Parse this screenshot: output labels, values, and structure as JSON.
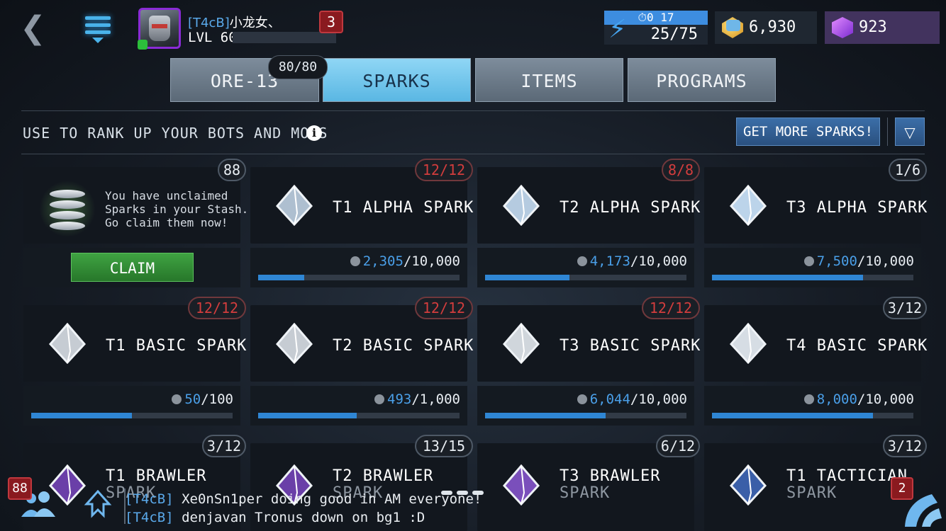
{
  "header": {
    "back_icon": "chevron-left-icon",
    "menu_icon": "menu-icon",
    "player": {
      "tag": "[T4cB]",
      "name": "小龙女、",
      "level": "LVL 60",
      "notifications": "3"
    },
    "energy": {
      "timer": "⏱0 17",
      "value": "25/75",
      "icon": "lightning-icon"
    },
    "gold": {
      "value": "6,930",
      "icon": "gold-icon"
    },
    "gems": {
      "value": "923",
      "icon": "gem-icon"
    }
  },
  "tabs": [
    {
      "label": "ORE-13",
      "active": false
    },
    {
      "label": "SPARKS",
      "active": true
    },
    {
      "label": "ITEMS",
      "active": false
    },
    {
      "label": "PROGRAMS",
      "active": false
    }
  ],
  "ore_count": "80/80",
  "subtitle": "USE TO RANK UP YOUR BOTS AND MODS",
  "info_icon": "i",
  "get_more_label": "GET MORE SPARKS!",
  "filter_icon": "filter-icon",
  "stash": {
    "count": "88",
    "text_line1": "You have unclaimed",
    "text_line2": "Sparks in your Stash.",
    "text_line3": "Go claim them now!",
    "claim_label": "CLAIM"
  },
  "sparks": [
    {
      "name": "T1 ALPHA SPARK",
      "badge": "12/12",
      "full": true,
      "current": "2,305",
      "max": "/10,000",
      "progress": 0.23,
      "color": "#aebfd0"
    },
    {
      "name": "T2 ALPHA SPARK",
      "badge": "8/8",
      "full": true,
      "current": "4,173",
      "max": "/10,000",
      "progress": 0.42,
      "color": "#b5cbe0"
    },
    {
      "name": "T3 ALPHA SPARK",
      "badge": "1/6",
      "full": false,
      "current": "7,500",
      "max": "/10,000",
      "progress": 0.75,
      "color": "#bcd4ea"
    },
    {
      "name": "T1 BASIC SPARK",
      "badge": "12/12",
      "full": true,
      "current": "50",
      "max": "/100",
      "progress": 0.5,
      "color": "#c6ccd3"
    },
    {
      "name": "T2 BASIC SPARK",
      "badge": "12/12",
      "full": true,
      "current": "493",
      "max": "/1,000",
      "progress": 0.49,
      "color": "#c6ccd3"
    },
    {
      "name": "T3 BASIC SPARK",
      "badge": "12/12",
      "full": true,
      "current": "6,044",
      "max": "/10,000",
      "progress": 0.6,
      "color": "#d0d6dc"
    },
    {
      "name": "T4 BASIC SPARK",
      "badge": "3/12",
      "full": false,
      "current": "8,000",
      "max": "/10,000",
      "progress": 0.8,
      "color": "#d6dde4"
    },
    {
      "name": "T1 BRAWLER",
      "sub": "SPARK",
      "badge": "3/12",
      "full": false,
      "color": "#6a3fa8"
    },
    {
      "name": "T2 BRAWLER",
      "sub": "SPARK",
      "badge": "13/15",
      "full": false,
      "color": "#6a3fa8"
    },
    {
      "name": "T3 BRAWLER",
      "sub": "SPARK",
      "badge": "6/12",
      "full": false,
      "color": "#7a4fbb"
    },
    {
      "name": "T1 TACTICIAN",
      "sub": "SPARK",
      "badge": "3/12",
      "full": false,
      "color": "#3a5fa8"
    }
  ],
  "chat": [
    {
      "tag": "[T4cB]",
      "text": " Xe0nSn1per doing good in AM everyone!"
    },
    {
      "tag": "[T4cB]",
      "text": " denjavan Tronus down on bg1 :D"
    }
  ],
  "bottom": {
    "friends_badge": "88",
    "friends_icon": "friends-icon",
    "alliance_icon": "alliance-icon",
    "right_badge": "2",
    "right_icon": "arena-icon"
  }
}
